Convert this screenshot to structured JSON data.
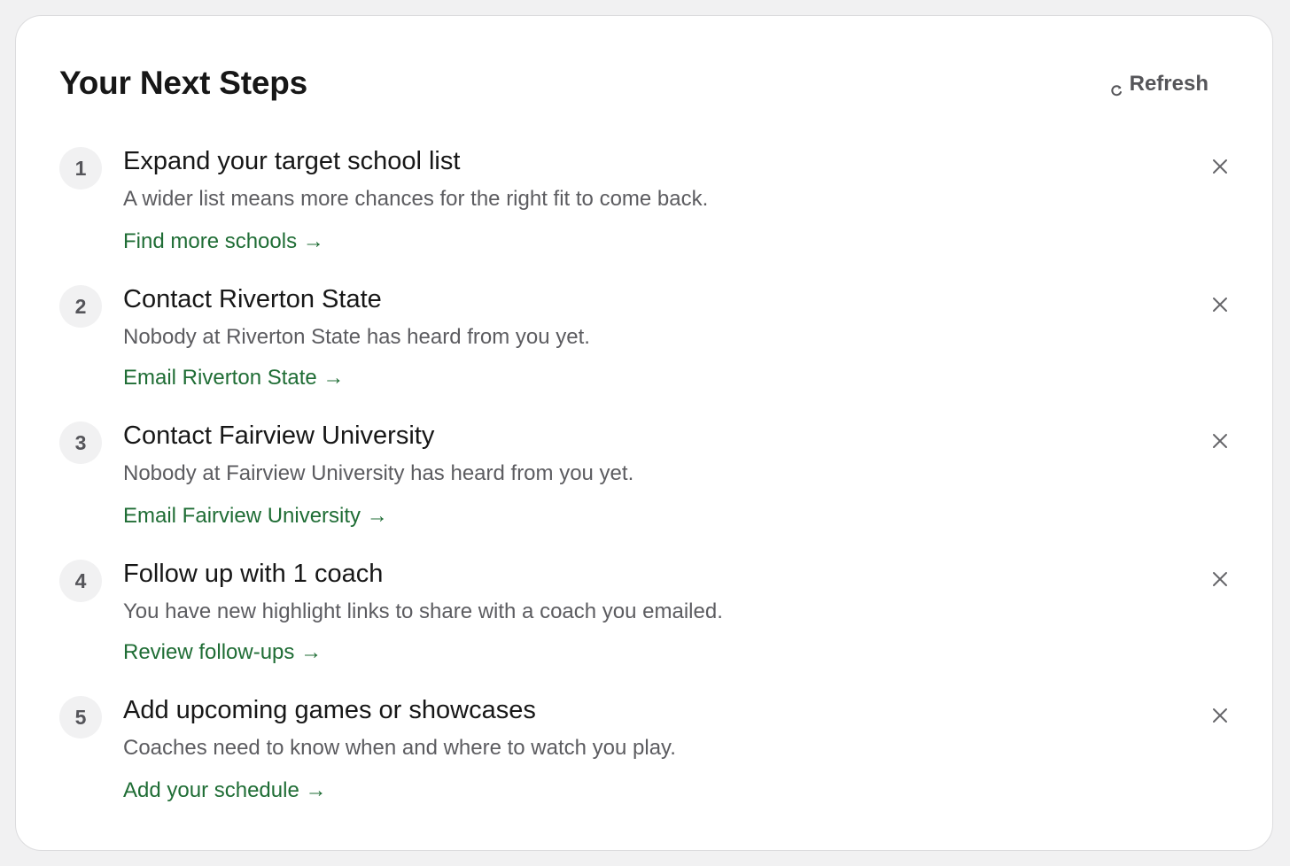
{
  "header": {
    "title": "Your Next Steps",
    "refresh_label": "Refresh",
    "refresh_icon": "refresh-icon"
  },
  "steps": [
    {
      "number": "1",
      "title": "Expand your target school list",
      "description": "A wider list means more chances for the right fit to come back.",
      "link": "Find more schools →",
      "dismiss_icon": "close-icon"
    },
    {
      "number": "2",
      "title": "Contact Riverton State",
      "description": "Nobody at Riverton State has heard from you yet.",
      "link": "Email Riverton State →",
      "dismiss_icon": "close-icon"
    },
    {
      "number": "3",
      "title": "Contact Fairview University",
      "description": "Nobody at Fairview University has heard from you yet.",
      "link": "Email Fairview University →",
      "dismiss_icon": "close-icon"
    },
    {
      "number": "4",
      "title": "Follow up with 1 coach",
      "description": "You have new highlight links to share with a coach you emailed.",
      "link": "Review follow-ups →",
      "dismiss_icon": "close-icon"
    },
    {
      "number": "5",
      "title": "Add upcoming games or showcases",
      "description": "Coaches need to know when and where to watch you play.",
      "link": "Add your schedule →",
      "dismiss_icon": "close-icon"
    }
  ],
  "colors": {
    "page_background": "#f1f1f2",
    "card_background": "#ffffff",
    "link_green": "#1f6d35",
    "text_primary": "#171717",
    "text_secondary": "#5c5c60"
  }
}
